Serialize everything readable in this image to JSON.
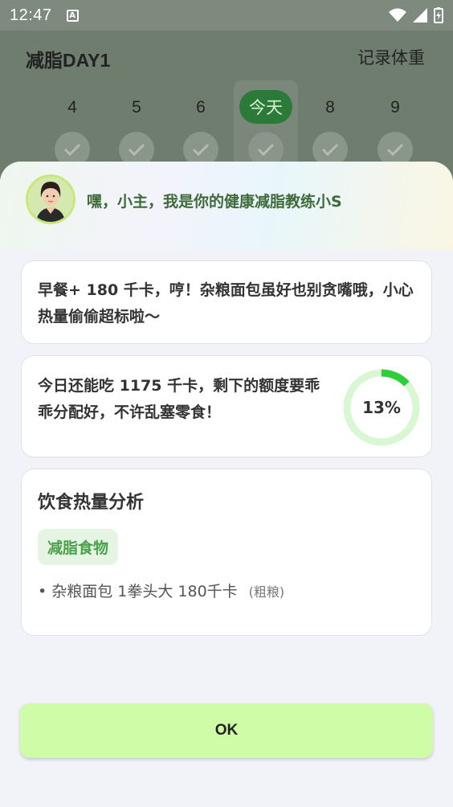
{
  "status_bar": {
    "time": "12:47",
    "badge": "A"
  },
  "header": {
    "title": "减脂DAY1",
    "record_weight": "记录体重"
  },
  "days": [
    {
      "label": "4"
    },
    {
      "label": "5"
    },
    {
      "label": "6"
    },
    {
      "label": "今天",
      "today": true
    },
    {
      "label": "8"
    },
    {
      "label": "9"
    }
  ],
  "coach": {
    "greeting": "嘿，小主，我是你的健康减脂教练小S"
  },
  "meal_card": {
    "message": "早餐+ 180 千卡，哼！杂粮面包虽好也别贪嘴哦，小心热量偷偷超标啦～"
  },
  "remaining_card": {
    "message": "今日还能吃 1175 千卡，剩下的额度要乖乖分配好，不许乱塞零食！",
    "percent_label": "13%",
    "percent_value": 0.13
  },
  "analysis": {
    "title": "饮食热量分析",
    "tag": "减脂食物",
    "items": [
      {
        "text": "杂粮面包 1拳头大 180千卡",
        "note": "(粗粮)"
      }
    ]
  },
  "ok_button": {
    "label": "OK"
  },
  "colors": {
    "accent_green": "#2ccf3a",
    "ring_track": "#d9f7d3",
    "button": "#cffca6",
    "tag_bg": "#e6f5e3"
  }
}
